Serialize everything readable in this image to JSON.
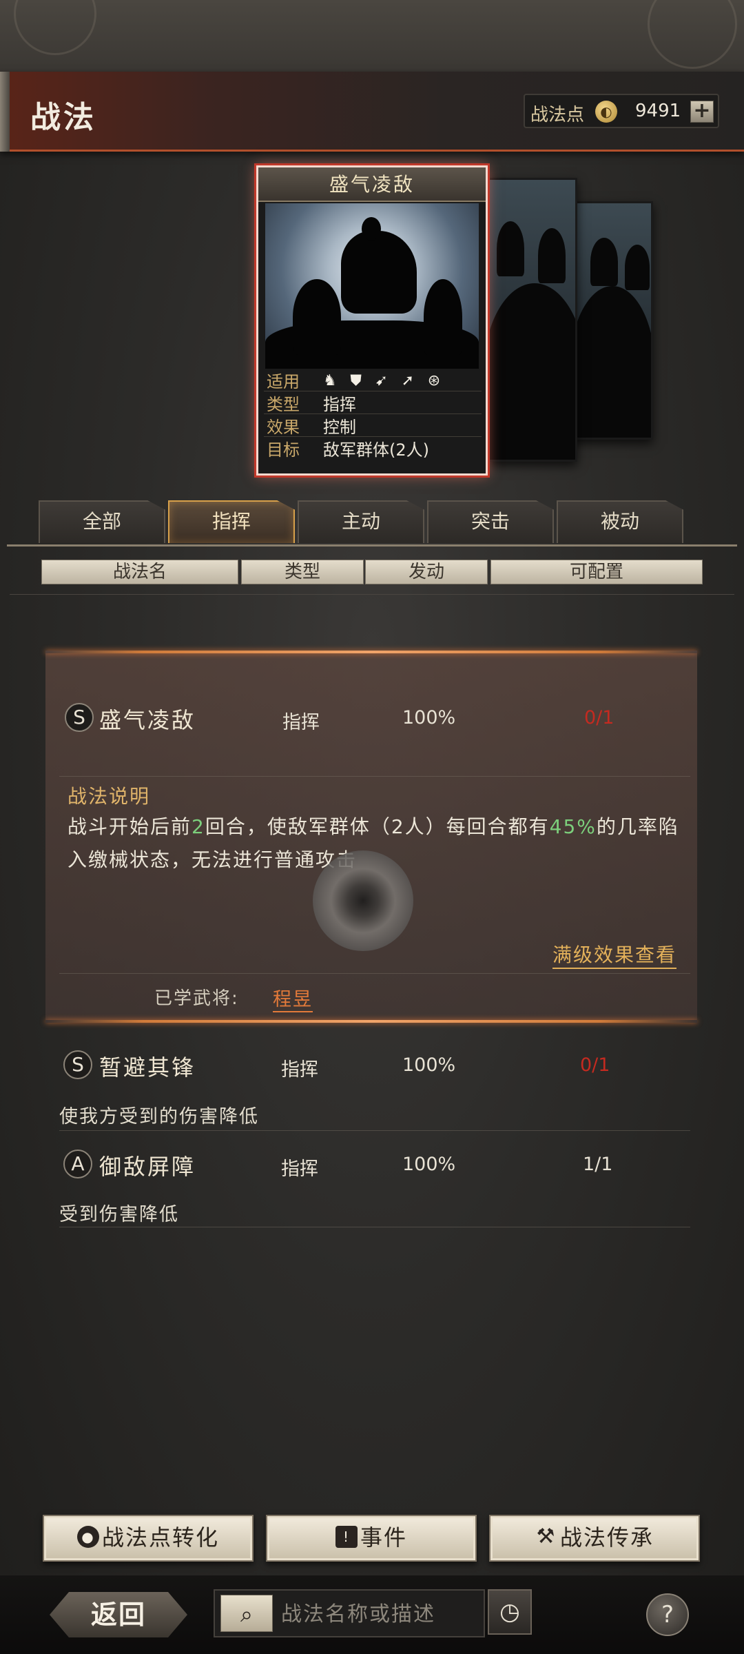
{
  "header": {
    "title": "战法"
  },
  "points": {
    "label": "战法点",
    "coin_icon": "coin-icon",
    "value": "9491",
    "add_label": "+"
  },
  "card": {
    "name": "盛气凌敌",
    "rows": [
      {
        "key": "适用",
        "value": ""
      },
      {
        "key": "类型",
        "value": "指挥"
      },
      {
        "key": "效果",
        "value": "控制"
      },
      {
        "key": "目标",
        "value": "敌军群体(2人)"
      }
    ],
    "unit_icons": [
      "cavalry-icon",
      "shield-icon",
      "bow-icon",
      "spear-icon",
      "chariot-icon"
    ]
  },
  "tabs": [
    {
      "label": "全部",
      "active": false
    },
    {
      "label": "指挥",
      "active": true
    },
    {
      "label": "主动",
      "active": false
    },
    {
      "label": "突击",
      "active": false
    },
    {
      "label": "被动",
      "active": false
    }
  ],
  "columns": [
    "战法名",
    "类型",
    "发动",
    "可配置"
  ],
  "skills": [
    {
      "grade": "S",
      "name": "盛气凌敌",
      "type": "指挥",
      "rate": "100%",
      "config": "0/1",
      "desc_title": "战法说明",
      "desc_parts": [
        "战斗开始后前",
        "2",
        "回合，使敌军群体（2人）每回合都有",
        "45%",
        "的几率陷入缴械状态，无法进行普通攻击"
      ],
      "max_link": "满级效果查看",
      "learned_label": "已学武将:",
      "learned_general": "程昱"
    },
    {
      "grade": "S",
      "name": "暂避其锋",
      "type": "指挥",
      "rate": "100%",
      "config": "0/1",
      "desc": "使我方受到的伤害降低"
    },
    {
      "grade": "A",
      "name": "御敌屏障",
      "type": "指挥",
      "rate": "100%",
      "config": "1/1",
      "desc": "受到伤害降低"
    }
  ],
  "buttons": [
    {
      "label": "战法点转化",
      "icon": "drop-icon"
    },
    {
      "label": "事件",
      "icon": "alert-icon"
    },
    {
      "label": "战法传承",
      "icon": "hammer-icon"
    }
  ],
  "footer": {
    "back_label": "返回",
    "search_placeholder": "战法名称或描述",
    "help_label": "?"
  },
  "colors": {
    "accent": "#d07b3a",
    "warning": "#c42a20",
    "highlight": "#7ccf7c",
    "gold": "#e3b15a"
  }
}
